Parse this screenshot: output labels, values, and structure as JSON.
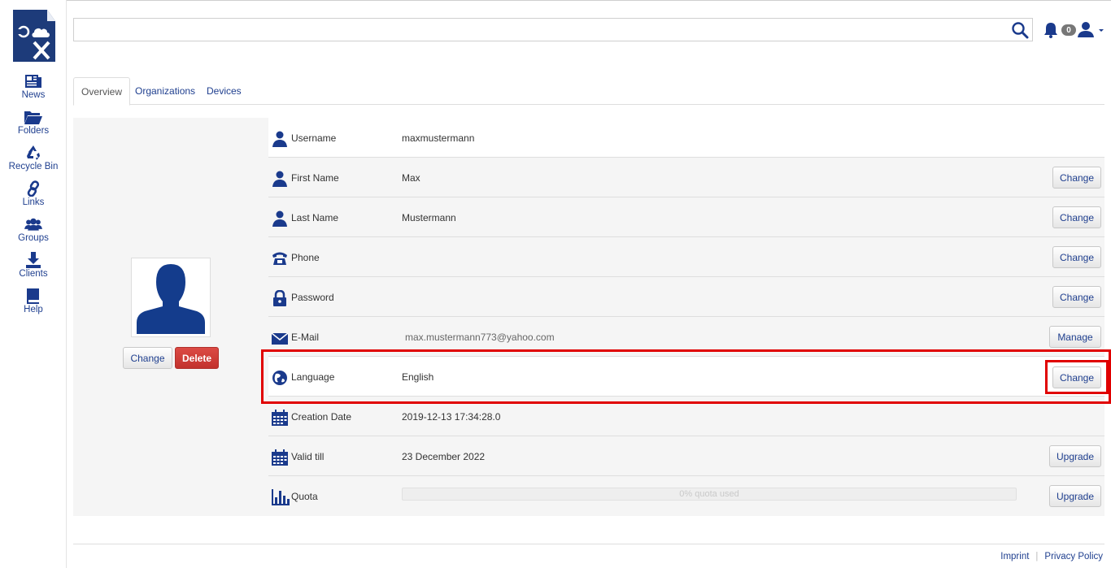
{
  "colors": {
    "accent": "#1f3f8f",
    "icon": "#1a3a8c",
    "danger": "#c9302c",
    "highlight": "#e00000"
  },
  "sidebar": {
    "items": [
      {
        "label": "News",
        "icon": "newspaper-icon"
      },
      {
        "label": "Folders",
        "icon": "folder-icon"
      },
      {
        "label": "Recycle Bin",
        "icon": "recycle-icon"
      },
      {
        "label": "Links",
        "icon": "link-icon"
      },
      {
        "label": "Groups",
        "icon": "users-icon"
      },
      {
        "label": "Clients",
        "icon": "download-icon"
      },
      {
        "label": "Help",
        "icon": "book-icon"
      }
    ]
  },
  "header": {
    "search_value": "",
    "notification_count": "0"
  },
  "tabs": [
    {
      "label": "Overview",
      "active": true
    },
    {
      "label": "Organizations",
      "active": false
    },
    {
      "label": "Devices",
      "active": false
    }
  ],
  "avatar": {
    "change_label": "Change",
    "delete_label": "Delete"
  },
  "profile": {
    "username": {
      "label": "Username",
      "value": "maxmustermann"
    },
    "first_name": {
      "label": "First Name",
      "value": "Max",
      "action": "Change"
    },
    "last_name": {
      "label": "Last Name",
      "value": "Mustermann",
      "action": "Change"
    },
    "phone": {
      "label": "Phone",
      "value": "",
      "action": "Change"
    },
    "password": {
      "label": "Password",
      "value": "",
      "action": "Change"
    },
    "email": {
      "label": "E-Mail",
      "value": "max.mustermann773@yahoo.com",
      "action": "Manage"
    },
    "language": {
      "label": "Language",
      "value": "English",
      "action": "Change"
    },
    "creation_date": {
      "label": "Creation Date",
      "value": "2019-12-13 17:34:28.0"
    },
    "valid_till": {
      "label": "Valid till",
      "value": "23 December 2022",
      "action": "Upgrade"
    },
    "quota": {
      "label": "Quota",
      "fraction_used": 0,
      "text": "0% quota used",
      "action": "Upgrade"
    }
  },
  "footer": {
    "imprint": "Imprint",
    "privacy": "Privacy Policy"
  }
}
